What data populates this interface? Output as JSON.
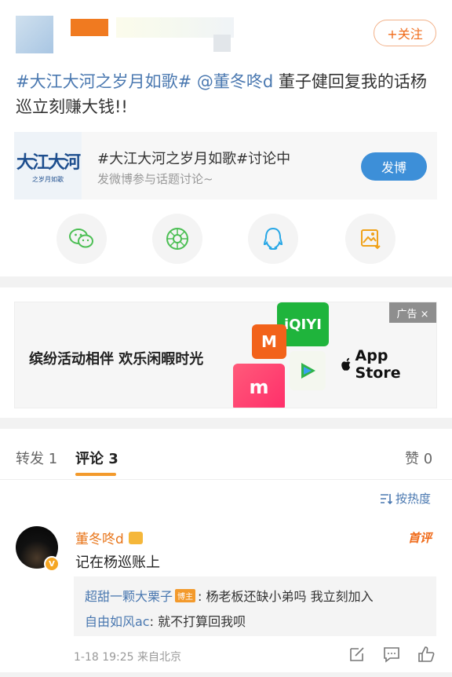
{
  "header": {
    "follow_label": "+关注"
  },
  "post": {
    "tag": "#大江大河之岁月如歌#",
    "mention": "@董冬咚d",
    "text": " 董子健回复我的话杨巡立刻赚大钱!!"
  },
  "topic_card": {
    "thumb_title": "大江大河",
    "thumb_sub": "之岁月如歌",
    "title": "#大江大河之岁月如歌#讨论中",
    "subtitle": "发微博参与话题讨论~",
    "button": "发博"
  },
  "share_icons": [
    "wechat-icon",
    "moments-icon",
    "qq-icon",
    "save-image-icon"
  ],
  "ad": {
    "text": "缤纷活动相伴 欢乐闲暇时光",
    "tag": "广告 ×",
    "store": "App Store",
    "store_icon": "apple-icon",
    "apps": [
      "iQIYI",
      "MGTV",
      "Meitu",
      "TencentVideo"
    ]
  },
  "tabs": [
    {
      "label": "转发 1"
    },
    {
      "label": "评论 3"
    },
    {
      "label": "赞 0"
    }
  ],
  "sort_label": "按热度",
  "comment": {
    "author": "董冬咚d",
    "featured": "首评",
    "text": "记在杨巡账上",
    "replies": [
      {
        "user": "超甜一颗大栗子",
        "badge": "博主",
        "text": ": 杨老板还缺小弟吗 我立刻加入"
      },
      {
        "user": "自由如风ac",
        "text": ": 就不打算回我呗"
      }
    ],
    "time": "1-18 19:25",
    "location": "来自北京"
  },
  "colors": {
    "accent_orange": "#f06b1a",
    "link_blue": "#4a78b0",
    "button_blue": "#3d8fd8"
  }
}
